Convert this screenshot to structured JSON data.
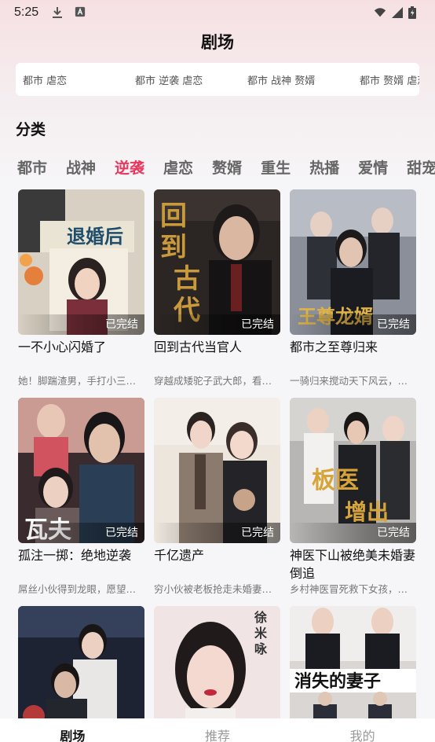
{
  "status_bar": {
    "time": "5:25"
  },
  "header": {
    "title": "剧场"
  },
  "tag_marquee": [
    "都市 虐恋",
    "都市 逆袭 虐恋",
    "都市 战神 赘婿",
    "都市 赘婿 虐恋"
  ],
  "category": {
    "title": "分类",
    "tabs": [
      "都市",
      "战神",
      "逆袭",
      "虐恋",
      "赘婿",
      "重生",
      "热播",
      "爱情",
      "甜宠"
    ],
    "active": "逆袭"
  },
  "dramas": [
    {
      "title": "一不小心闪婚了",
      "desc": "她！脚踹渣男，手打小三…",
      "status": "已完结",
      "poster_text": "退婚后"
    },
    {
      "title": "回到古代当官人",
      "desc": "穿越成矮驼子武大郎，看…",
      "status": "已完结",
      "poster_text": "回到古代当官"
    },
    {
      "title": "都市之至尊归来",
      "desc": "一骑归来搅动天下风云，…",
      "status": "已完结",
      "poster_text": "至尊龙婿"
    },
    {
      "title": "孤注一掷：绝地逆袭",
      "desc": "屌丝小伙得到龙眼，愿望…",
      "status": "已完结",
      "poster_text": "瓦夫"
    },
    {
      "title": "千亿遗产",
      "desc": "穷小伙被老板抢走未婚妻…",
      "status": "已完结",
      "poster_text": ""
    },
    {
      "title": "神医下山被绝美未婚妻倒追",
      "desc": "乡村神医冒死救下女孩，…",
      "status": "已完结",
      "poster_text": "板医增出山"
    },
    {
      "title": "",
      "desc": "",
      "status": "",
      "poster_text": ""
    },
    {
      "title": "",
      "desc": "",
      "status": "",
      "poster_text": "徐米咏"
    },
    {
      "title": "",
      "desc": "",
      "status": "",
      "poster_text": "消失的妻子"
    }
  ],
  "bottom_nav": [
    "剧场",
    "推荐",
    "我的"
  ],
  "colors": {
    "accent": "#e8385e",
    "background": "#f6f5f7"
  }
}
